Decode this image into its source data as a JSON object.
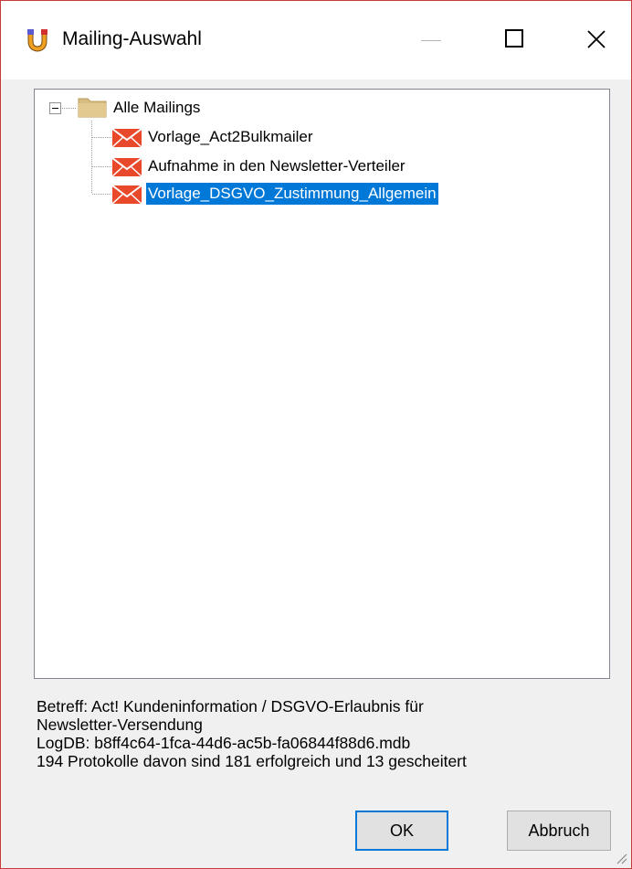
{
  "window": {
    "title": "Mailing-Auswahl",
    "icon": "mailing-app-icon",
    "controls": [
      "minimize-icon",
      "maximize-icon",
      "close-icon"
    ]
  },
  "tree": {
    "root": {
      "label": "Alle Mailings",
      "icon": "folder-icon",
      "expander": "collapse-minus-icon"
    },
    "items": [
      {
        "label": "Vorlage_Act2Bulkmailer",
        "icon": "envelope-icon",
        "selected": false
      },
      {
        "label": "Aufnahme in den Newsletter-Verteiler",
        "icon": "envelope-icon",
        "selected": false
      },
      {
        "label": "Vorlage_DSGVO_Zustimmung_Allgemein",
        "icon": "envelope-icon",
        "selected": true
      }
    ]
  },
  "info": {
    "line1": "Betreff: Act! Kundeninformation / DSGVO-Erlaubnis für",
    "line2": "Newsletter-Versendung",
    "line3": "LogDB: b8ff4c64-1fca-44d6-ac5b-fa06844f88d6.mdb",
    "line4": "194 Protokolle davon sind 181 erfolgreich und 13 gescheitert"
  },
  "buttons": {
    "ok": "OK",
    "cancel": "Abbruch"
  },
  "colors": {
    "selection": "#0078d7",
    "envelope": "#e8492b",
    "window_border": "#c63a3a"
  }
}
